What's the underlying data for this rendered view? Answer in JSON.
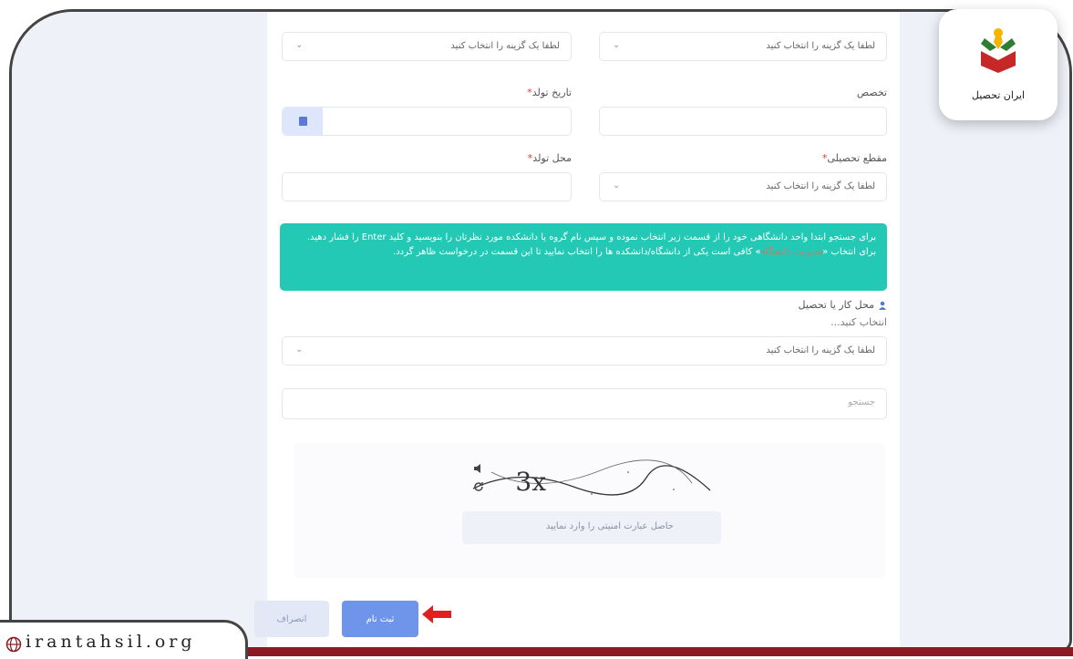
{
  "form": {
    "row0": {
      "right_select_text": "لطفا یک گزینه را انتخاب کنید",
      "left_select_text": "لطفا یک گزینه را انتخاب کنید"
    },
    "row1": {
      "right_label": "تخصص",
      "left_label": "تاریخ تولد"
    },
    "row2": {
      "right_label": "مقطع تحصیلی",
      "right_select_text": "لطفا یک گزینه را انتخاب کنید",
      "left_label": "محل تولد"
    },
    "info": {
      "line1_pre": "برای جستجو ابتدا واحد دانشگاهی خود را از قسمت زیر انتخاب نموده و سپس نام گروه یا دانشکده مورد نظرتان را بنویسید و کلید",
      "line1_key": "Enter",
      "line1_post": "را فشار دهید.",
      "line2_pre": "برای انتخاب «",
      "line2_hl": "مدیریت دانشگاه",
      "line2_post": "» کافی است یکی از دانشگاه/دانشکده ها را انتخاب نمایید تا این قسمت در درخواست ظاهر گردد."
    },
    "workplace": {
      "label": "محل کار یا تحصیل",
      "sublabel": "انتخاب کنید...",
      "select_text": "لطفا یک گزینه را انتخاب کنید"
    },
    "search": {
      "placeholder": "جستجو"
    },
    "captcha": {
      "code": "3x",
      "input_placeholder": "حاصل عبارت امنیتی را وارد نمایید"
    },
    "buttons": {
      "submit": "ثبت نام",
      "cancel": "انصراف"
    }
  },
  "branding": {
    "logo_text": "ایران تحصیل",
    "url": "irantahsil.org"
  }
}
